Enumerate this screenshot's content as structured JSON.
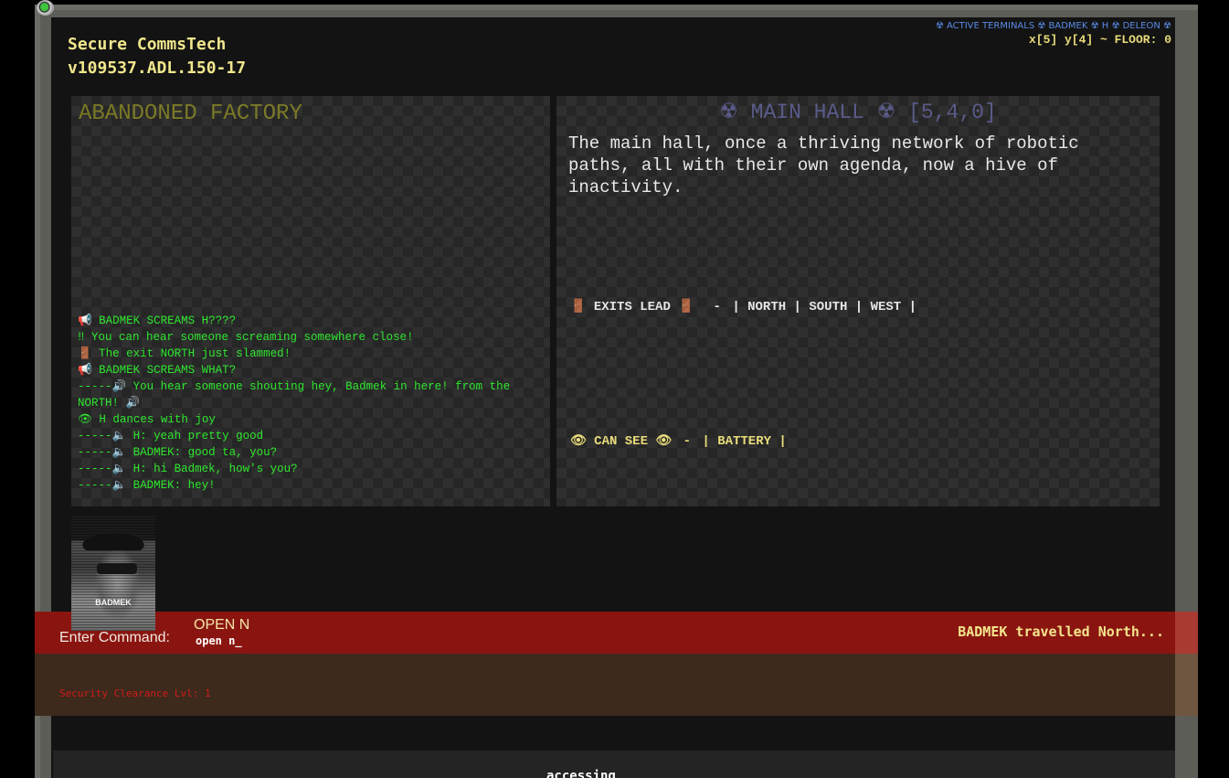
{
  "app": {
    "brand_line1": "Secure CommsTech",
    "brand_line2": "v109537.ADL.150-17"
  },
  "header": {
    "active_terminals": "☢ ACTIVE TERMINALS ☢ BADMEK ☢ H ☢ DELEON ☢",
    "coordinates": "x[5] y[4] ~ FLOOR: 0"
  },
  "zone": {
    "title": "ABANDONED FACTORY"
  },
  "log": [
    "📢 BADMEK SCREAMS H????",
    "‼ You can hear someone screaming  somewhere close!",
    "🚪 The exit NORTH just slammed!",
    "📢 BADMEK SCREAMS WHAT?",
    "-----🔊 You hear someone shouting hey, Badmek in here! from the NORTH! 🔊",
    "👁 H dances with joy",
    "-----🔈 H: yeah pretty good",
    "-----🔈 BADMEK: good ta, you?",
    "-----🔈 H: hi Badmek, how's you?",
    "-----🔈 BADMEK: hey!"
  ],
  "room": {
    "title": "☢ MAIN HALL ☢ [5,4,0]",
    "description": "The main hall, once a thriving network of robotic paths, all with their own agenda, now a hive of inactivity.",
    "exits_label": "🚪 EXITS LEAD 🚪",
    "exits": [
      "NORTH",
      "SOUTH",
      "WEST"
    ],
    "can_see_label": "👁 CAN SEE 👁",
    "visible_items": [
      "BATTERY"
    ]
  },
  "player": {
    "avatar_name": "BADMEK"
  },
  "command": {
    "label": "Enter Command:",
    "last_command": "OPEN N",
    "input_value": "open n_",
    "status": "BADMEK travelled North..."
  },
  "security": {
    "clearance": "Security Clearance Lvl: 1"
  },
  "footer": {
    "status_text": "accessing"
  },
  "colors": {
    "brand": "#f0e68c",
    "log_green": "#2ee62e",
    "command_bar": "#8a1510",
    "security_red": "#d11a1a",
    "terminals_blue": "#5a8be6"
  }
}
